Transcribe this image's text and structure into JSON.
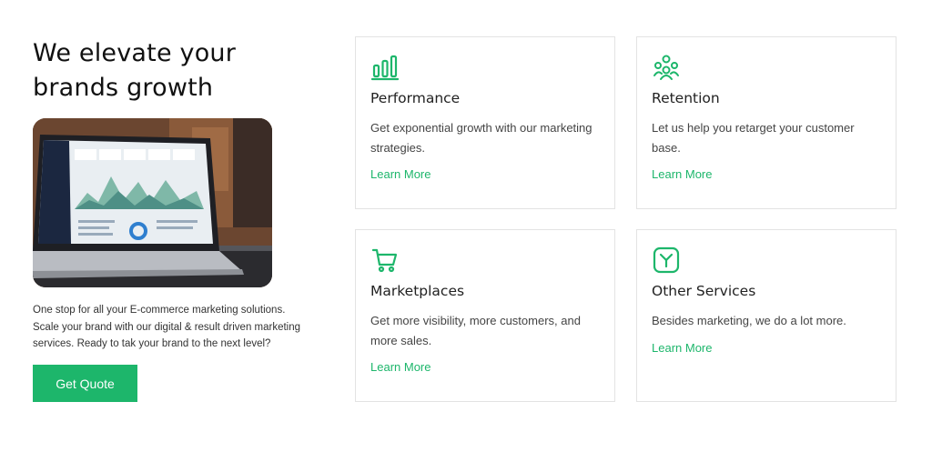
{
  "hero": {
    "headline": "We elevate your brands growth",
    "description": "One stop for all your E-commerce marketing solutions. Scale your brand with our digital & result driven marketing services. Ready to tak your brand to the next level?",
    "cta_label": "Get Quote"
  },
  "accent_color": "#1db66b",
  "services": [
    {
      "icon": "bar-chart-icon",
      "title": "Performance",
      "text": "Get exponential growth with our marketing strategies.",
      "link": "Learn More"
    },
    {
      "icon": "people-group-icon",
      "title": "Retention",
      "text": "Let us help you retarget your customer base.",
      "link": "Learn More"
    },
    {
      "icon": "shopping-cart-icon",
      "title": "Marketplaces",
      "text": "Get more visibility, more customers, and more sales.",
      "link": "Learn More"
    },
    {
      "icon": "split-arrow-icon",
      "title": "Other Services",
      "text": "Besides marketing, we do a lot more.",
      "link": "Learn More"
    }
  ]
}
